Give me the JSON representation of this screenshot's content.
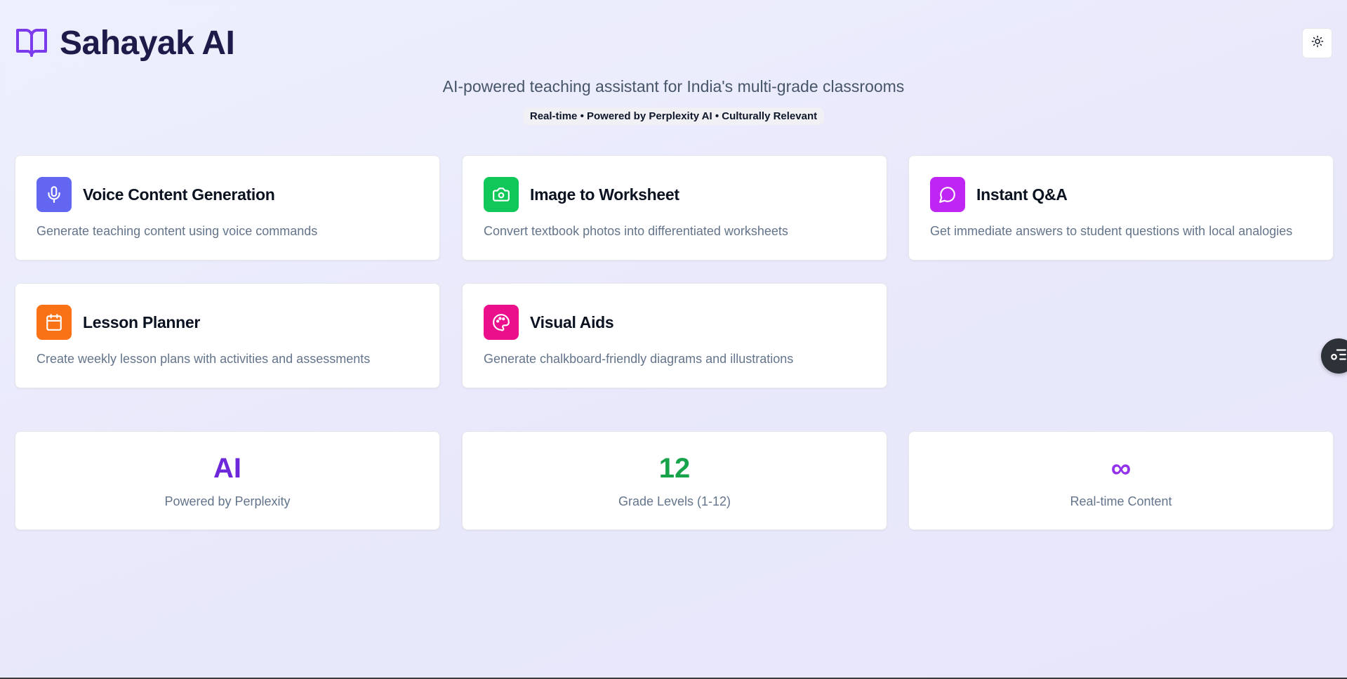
{
  "header": {
    "title": "Sahayak AI",
    "logo_icon": "book-open-icon",
    "theme_toggle_icon": "sun-icon"
  },
  "hero": {
    "subtitle": "AI-powered teaching assistant for India's multi-grade classrooms",
    "badge": "Real-time • Powered by Perplexity AI • Culturally Relevant"
  },
  "features": [
    {
      "title": "Voice Content Generation",
      "description": "Generate teaching content using voice commands",
      "icon": "microphone-icon",
      "color": "#6366f1"
    },
    {
      "title": "Image to Worksheet",
      "description": "Convert textbook photos into differentiated worksheets",
      "icon": "camera-icon",
      "color": "#10c859"
    },
    {
      "title": "Instant Q&A",
      "description": "Get immediate answers to student questions with local analogies",
      "icon": "message-circle-icon",
      "color": "#c026f3"
    },
    {
      "title": "Lesson Planner",
      "description": "Create weekly lesson plans with activities and assessments",
      "icon": "calendar-icon",
      "color": "#f97316"
    },
    {
      "title": "Visual Aids",
      "description": "Generate chalkboard-friendly diagrams and illustrations",
      "icon": "palette-icon",
      "color": "#ec0f8c"
    }
  ],
  "stats": [
    {
      "value": "AI",
      "label": "Powered by Perplexity",
      "color": "#6d28d9"
    },
    {
      "value": "12",
      "label": "Grade Levels (1-12)",
      "color": "#16a34a"
    },
    {
      "value": "∞",
      "label": "Real-time Content",
      "color": "#9333ea"
    }
  ],
  "floating_button": {
    "icon": "list-settings-icon"
  }
}
